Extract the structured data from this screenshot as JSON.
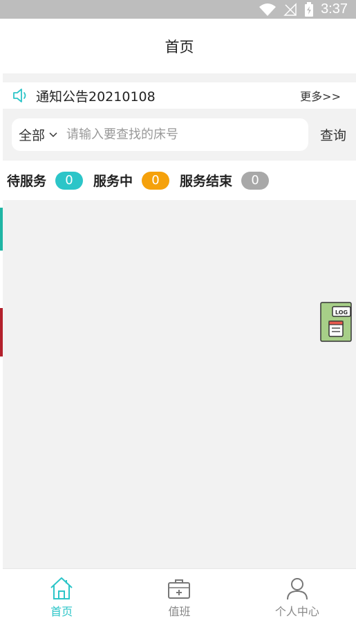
{
  "status_bar": {
    "time": "3:37"
  },
  "header": {
    "title": "首页"
  },
  "notice": {
    "text": "通知公告20210108",
    "more": "更多>>"
  },
  "search": {
    "filter_value": "全部",
    "placeholder": "请输入要查找的床号",
    "button_label": "查询"
  },
  "stats": [
    {
      "label": "待服务",
      "count": "0",
      "color": "#2cc5c8"
    },
    {
      "label": "服务中",
      "count": "0",
      "color": "#f5a10b"
    },
    {
      "label": "服务结束",
      "count": "0",
      "color": "#a8a8a8"
    }
  ],
  "floating": {
    "log_label": "LOG"
  },
  "bottom_nav": [
    {
      "label": "首页",
      "icon": "home-icon",
      "active": true
    },
    {
      "label": "值班",
      "icon": "medical-kit-icon",
      "active": false
    },
    {
      "label": "个人中心",
      "icon": "user-icon",
      "active": false
    }
  ],
  "colors": {
    "accent": "#2cc5c8",
    "orange": "#f5a10b",
    "gray_badge": "#a8a8a8"
  }
}
